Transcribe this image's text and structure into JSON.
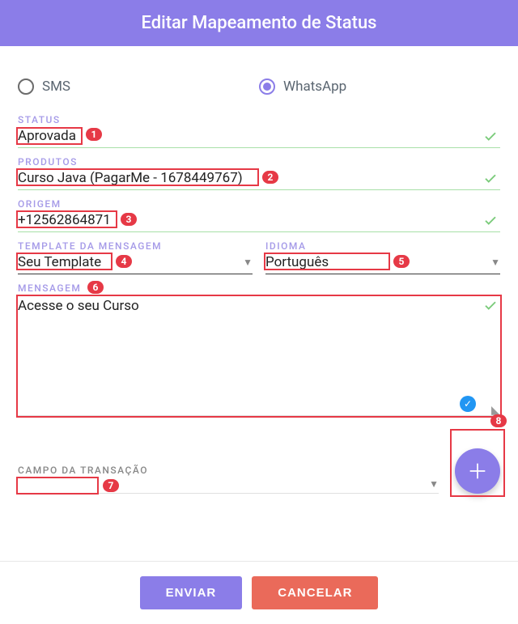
{
  "header": {
    "title": "Editar Mapeamento de Status"
  },
  "channel": {
    "sms_label": "SMS",
    "whatsapp_label": "WhatsApp",
    "selected": "whatsapp"
  },
  "form": {
    "status": {
      "label": "STATUS",
      "value": "Aprovada"
    },
    "products": {
      "label": "PRODUTOS",
      "value": "Curso Java (PagarMe - 1678449767)"
    },
    "origin": {
      "label": "ORIGEM",
      "value": "+12562864871"
    },
    "template": {
      "label": "TEMPLATE DA MENSAGEM",
      "value": "Seu Template"
    },
    "language": {
      "label": "IDIOMA",
      "value": "Português"
    },
    "message": {
      "label": "MENSAGEM",
      "value": "Acesse o seu Curso"
    },
    "transaction": {
      "label": "CAMPO DA TRANSAÇÃO",
      "value": ""
    }
  },
  "footer": {
    "submit_label": "ENVIAR",
    "cancel_label": "CANCELAR"
  },
  "annotations": {
    "n1": "1",
    "n2": "2",
    "n3": "3",
    "n4": "4",
    "n5": "5",
    "n6": "6",
    "n7": "7",
    "n8": "8"
  }
}
